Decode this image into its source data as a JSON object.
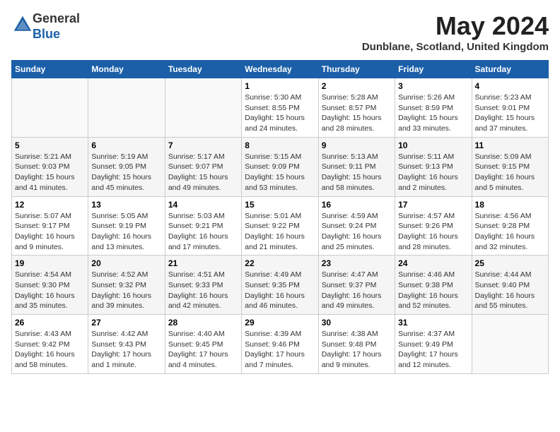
{
  "header": {
    "logo_general": "General",
    "logo_blue": "Blue",
    "month": "May 2024",
    "location": "Dunblane, Scotland, United Kingdom"
  },
  "weekdays": [
    "Sunday",
    "Monday",
    "Tuesday",
    "Wednesday",
    "Thursday",
    "Friday",
    "Saturday"
  ],
  "weeks": [
    [
      {
        "day": "",
        "info": ""
      },
      {
        "day": "",
        "info": ""
      },
      {
        "day": "",
        "info": ""
      },
      {
        "day": "1",
        "info": "Sunrise: 5:30 AM\nSunset: 8:55 PM\nDaylight: 15 hours\nand 24 minutes."
      },
      {
        "day": "2",
        "info": "Sunrise: 5:28 AM\nSunset: 8:57 PM\nDaylight: 15 hours\nand 28 minutes."
      },
      {
        "day": "3",
        "info": "Sunrise: 5:26 AM\nSunset: 8:59 PM\nDaylight: 15 hours\nand 33 minutes."
      },
      {
        "day": "4",
        "info": "Sunrise: 5:23 AM\nSunset: 9:01 PM\nDaylight: 15 hours\nand 37 minutes."
      }
    ],
    [
      {
        "day": "5",
        "info": "Sunrise: 5:21 AM\nSunset: 9:03 PM\nDaylight: 15 hours\nand 41 minutes."
      },
      {
        "day": "6",
        "info": "Sunrise: 5:19 AM\nSunset: 9:05 PM\nDaylight: 15 hours\nand 45 minutes."
      },
      {
        "day": "7",
        "info": "Sunrise: 5:17 AM\nSunset: 9:07 PM\nDaylight: 15 hours\nand 49 minutes."
      },
      {
        "day": "8",
        "info": "Sunrise: 5:15 AM\nSunset: 9:09 PM\nDaylight: 15 hours\nand 53 minutes."
      },
      {
        "day": "9",
        "info": "Sunrise: 5:13 AM\nSunset: 9:11 PM\nDaylight: 15 hours\nand 58 minutes."
      },
      {
        "day": "10",
        "info": "Sunrise: 5:11 AM\nSunset: 9:13 PM\nDaylight: 16 hours\nand 2 minutes."
      },
      {
        "day": "11",
        "info": "Sunrise: 5:09 AM\nSunset: 9:15 PM\nDaylight: 16 hours\nand 5 minutes."
      }
    ],
    [
      {
        "day": "12",
        "info": "Sunrise: 5:07 AM\nSunset: 9:17 PM\nDaylight: 16 hours\nand 9 minutes."
      },
      {
        "day": "13",
        "info": "Sunrise: 5:05 AM\nSunset: 9:19 PM\nDaylight: 16 hours\nand 13 minutes."
      },
      {
        "day": "14",
        "info": "Sunrise: 5:03 AM\nSunset: 9:21 PM\nDaylight: 16 hours\nand 17 minutes."
      },
      {
        "day": "15",
        "info": "Sunrise: 5:01 AM\nSunset: 9:22 PM\nDaylight: 16 hours\nand 21 minutes."
      },
      {
        "day": "16",
        "info": "Sunrise: 4:59 AM\nSunset: 9:24 PM\nDaylight: 16 hours\nand 25 minutes."
      },
      {
        "day": "17",
        "info": "Sunrise: 4:57 AM\nSunset: 9:26 PM\nDaylight: 16 hours\nand 28 minutes."
      },
      {
        "day": "18",
        "info": "Sunrise: 4:56 AM\nSunset: 9:28 PM\nDaylight: 16 hours\nand 32 minutes."
      }
    ],
    [
      {
        "day": "19",
        "info": "Sunrise: 4:54 AM\nSunset: 9:30 PM\nDaylight: 16 hours\nand 35 minutes."
      },
      {
        "day": "20",
        "info": "Sunrise: 4:52 AM\nSunset: 9:32 PM\nDaylight: 16 hours\nand 39 minutes."
      },
      {
        "day": "21",
        "info": "Sunrise: 4:51 AM\nSunset: 9:33 PM\nDaylight: 16 hours\nand 42 minutes."
      },
      {
        "day": "22",
        "info": "Sunrise: 4:49 AM\nSunset: 9:35 PM\nDaylight: 16 hours\nand 46 minutes."
      },
      {
        "day": "23",
        "info": "Sunrise: 4:47 AM\nSunset: 9:37 PM\nDaylight: 16 hours\nand 49 minutes."
      },
      {
        "day": "24",
        "info": "Sunrise: 4:46 AM\nSunset: 9:38 PM\nDaylight: 16 hours\nand 52 minutes."
      },
      {
        "day": "25",
        "info": "Sunrise: 4:44 AM\nSunset: 9:40 PM\nDaylight: 16 hours\nand 55 minutes."
      }
    ],
    [
      {
        "day": "26",
        "info": "Sunrise: 4:43 AM\nSunset: 9:42 PM\nDaylight: 16 hours\nand 58 minutes."
      },
      {
        "day": "27",
        "info": "Sunrise: 4:42 AM\nSunset: 9:43 PM\nDaylight: 17 hours\nand 1 minute."
      },
      {
        "day": "28",
        "info": "Sunrise: 4:40 AM\nSunset: 9:45 PM\nDaylight: 17 hours\nand 4 minutes."
      },
      {
        "day": "29",
        "info": "Sunrise: 4:39 AM\nSunset: 9:46 PM\nDaylight: 17 hours\nand 7 minutes."
      },
      {
        "day": "30",
        "info": "Sunrise: 4:38 AM\nSunset: 9:48 PM\nDaylight: 17 hours\nand 9 minutes."
      },
      {
        "day": "31",
        "info": "Sunrise: 4:37 AM\nSunset: 9:49 PM\nDaylight: 17 hours\nand 12 minutes."
      },
      {
        "day": "",
        "info": ""
      }
    ]
  ]
}
